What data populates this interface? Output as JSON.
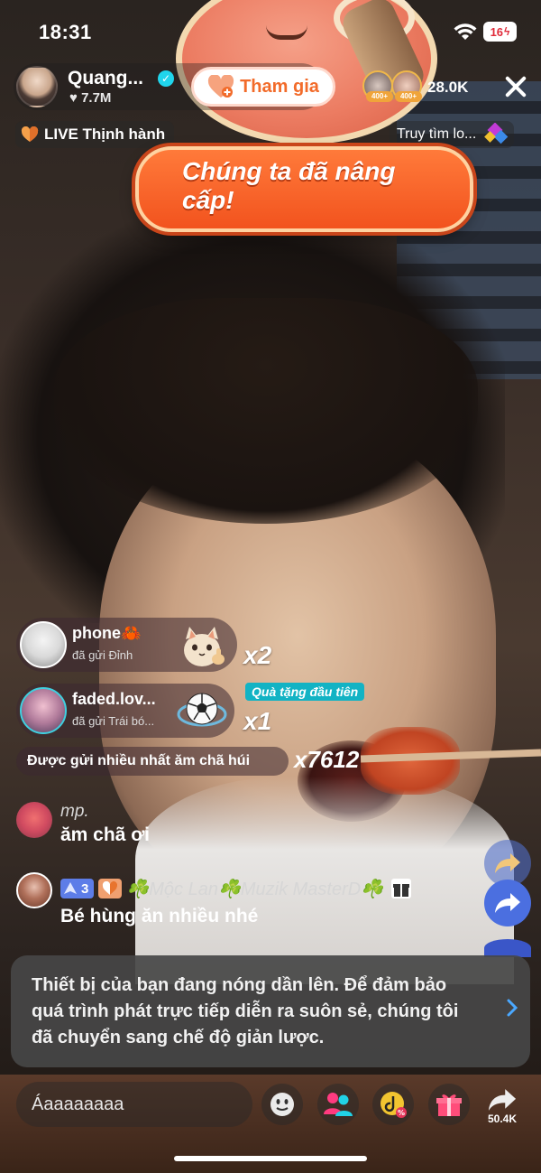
{
  "status_bar": {
    "time": "18:31",
    "battery": "16"
  },
  "host": {
    "name": "Quang...",
    "likes": "7.7M",
    "join_label": "Tham gia"
  },
  "viewers": {
    "badge": "400+",
    "count": "28.0K"
  },
  "badges": {
    "trending": "LIVE Thịnh hành",
    "explore": "Truy tìm lo..."
  },
  "banner": {
    "text": "Chúng ta đã nâng cấp!"
  },
  "gifts": [
    {
      "user": "phone🦀",
      "desc": "đã gửi Đỉnh",
      "count": "x2"
    },
    {
      "user": "faded.lov...",
      "desc": "đã gửi Trái bó...",
      "count": "x1",
      "badge": "Quà tặng đầu tiên"
    }
  ],
  "most_sent": {
    "label": "Được gửi nhiều nhất ăm chã húi",
    "count": "x7612"
  },
  "comments": [
    {
      "name": "mp.",
      "text": "ăm chã ơi"
    },
    {
      "level": "3",
      "name": "☘️Mộc Lan☘️Muzik MasterD☘️",
      "text": "Bé hùng ăn nhiều nhé"
    }
  ],
  "notice": {
    "text": "Thiết bị của bạn đang nóng dần lên. Để đảm bảo quá trình phát trực tiếp diễn ra suôn sẻ, chúng tôi đã chuyển sang chế độ giản lược."
  },
  "bottom_bar": {
    "input_value": "Áaaaaaaaa",
    "share_count": "50.4K"
  },
  "icons": [
    "wifi-icon",
    "verified-icon",
    "close-icon",
    "heart-icon",
    "search-icon",
    "gift-icon",
    "share-icon",
    "emoji-icon",
    "guests-icon",
    "promo-icon",
    "chevron-right-icon"
  ],
  "colors": {
    "accent": "#f26b2a",
    "verified": "#20d5ec",
    "badge_teal": "#12b3c4",
    "level_blue": "#5d7de8",
    "share_blue": "#4b6fe0"
  }
}
